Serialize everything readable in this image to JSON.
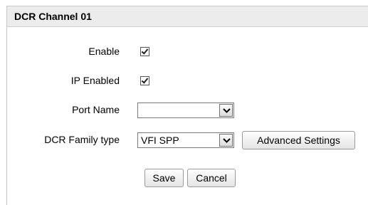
{
  "panel": {
    "title": "DCR Channel 01"
  },
  "form": {
    "enable_label": "Enable",
    "enable_checked": true,
    "ip_enabled_label": "IP Enabled",
    "ip_enabled_checked": true,
    "port_name_label": "Port Name",
    "port_name_value": "",
    "dcr_family_label": "DCR Family type",
    "dcr_family_value": "VFI SPP",
    "advanced_settings_label": "Advanced Settings"
  },
  "actions": {
    "save_label": "Save",
    "cancel_label": "Cancel"
  },
  "icons": {
    "checkbox": "checkmark-icon",
    "dropdown": "chevron-down-icon"
  }
}
